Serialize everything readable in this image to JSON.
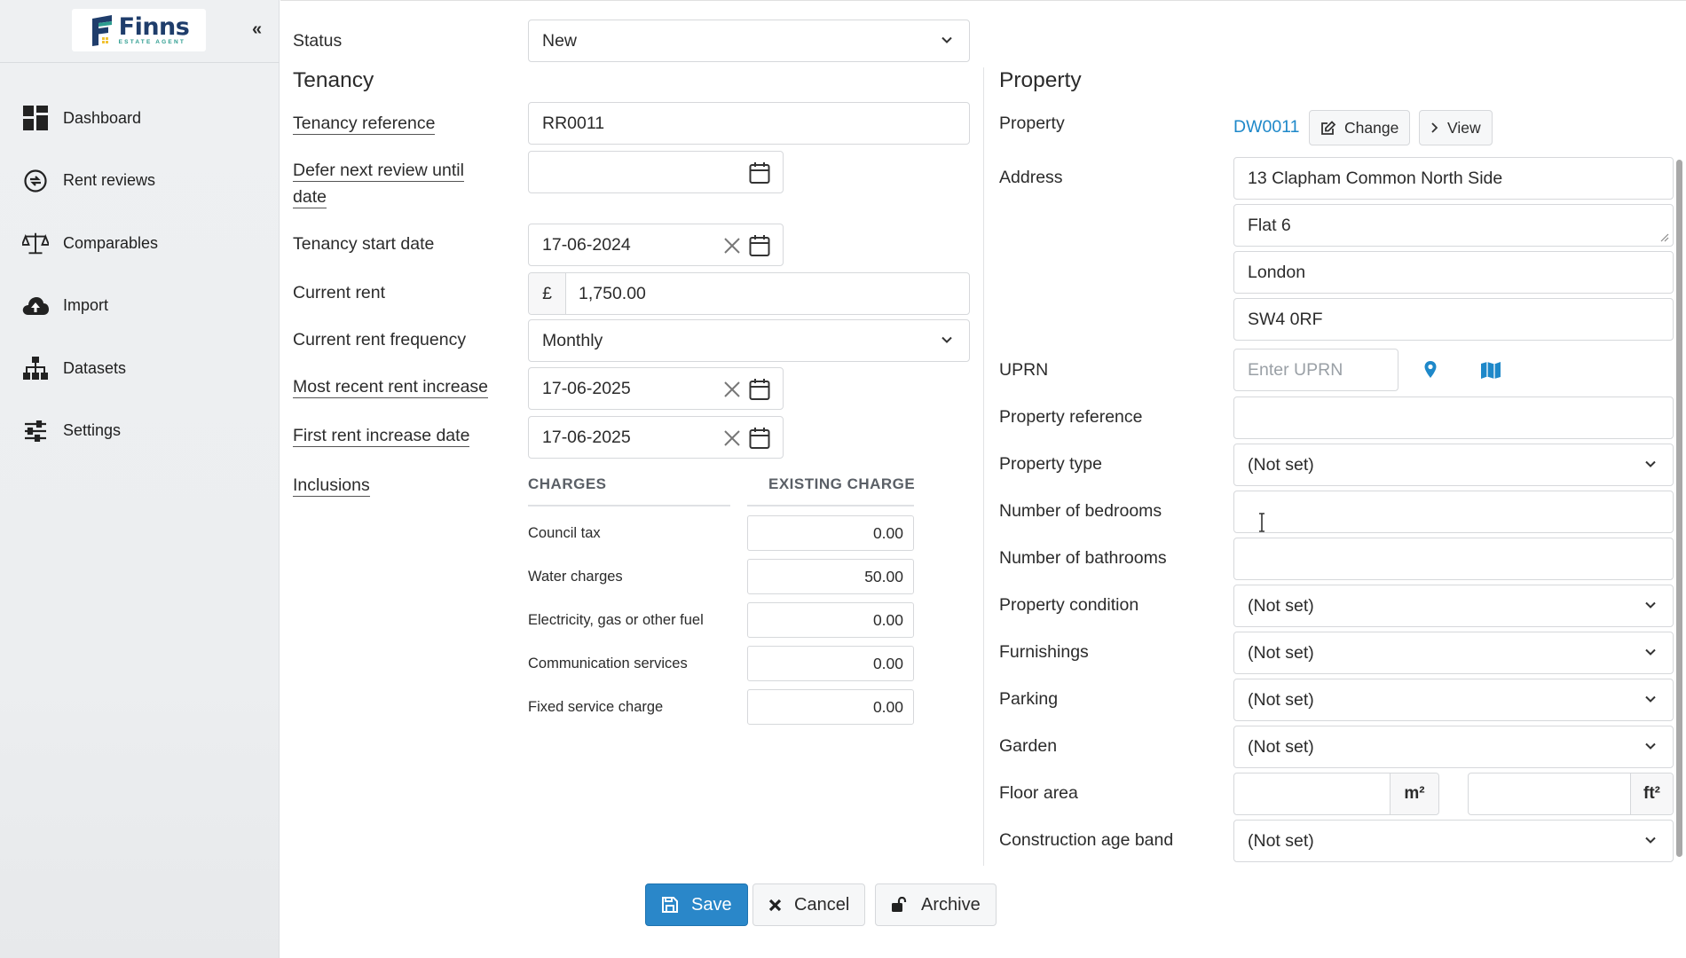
{
  "brand": {
    "name": "Finns",
    "tagline": "ESTATE AGENT"
  },
  "sidebar": {
    "collapse_icon": "«",
    "items": [
      {
        "label": "Dashboard",
        "icon": "dashboard-icon"
      },
      {
        "label": "Rent reviews",
        "icon": "rent-reviews-icon"
      },
      {
        "label": "Comparables",
        "icon": "scales-icon"
      },
      {
        "label": "Import",
        "icon": "cloud-upload-icon"
      },
      {
        "label": "Datasets",
        "icon": "sitemap-icon"
      },
      {
        "label": "Settings",
        "icon": "sliders-icon"
      }
    ]
  },
  "status": {
    "label": "Status",
    "value": "New"
  },
  "tenancy": {
    "title": "Tenancy",
    "reference": {
      "label": "Tenancy reference",
      "value": "RR0011"
    },
    "defer": {
      "label_line1": "Defer next review until",
      "label_line2": "date",
      "value": ""
    },
    "start_date": {
      "label": "Tenancy start date",
      "value": "17-06-2024"
    },
    "current_rent": {
      "label": "Current rent",
      "currency": "£",
      "value": "1,750.00"
    },
    "frequency": {
      "label": "Current rent frequency",
      "value": "Monthly"
    },
    "recent_increase": {
      "label": "Most recent rent increase",
      "value": "17-06-2025"
    },
    "first_increase": {
      "label": "First rent increase date",
      "value": "17-06-2025"
    },
    "inclusions": {
      "label": "Inclusions",
      "col_charges": "CHARGES",
      "col_existing": "EXISTING CHARGE",
      "rows": [
        {
          "name": "Council tax",
          "value": "0.00"
        },
        {
          "name": "Water charges",
          "value": "50.00"
        },
        {
          "name": "Electricity, gas or other fuel",
          "value": "0.00"
        },
        {
          "name": "Communication services",
          "value": "0.00"
        },
        {
          "name": "Fixed service charge",
          "value": "0.00"
        }
      ]
    }
  },
  "property": {
    "title": "Property",
    "property": {
      "label": "Property",
      "link": "DW0011",
      "change_label": "Change",
      "view_label": "View"
    },
    "address": {
      "label": "Address",
      "line1": "13 Clapham Common North Side",
      "line2": "Flat 6",
      "city": "London",
      "postcode": "SW4 0RF"
    },
    "uprn": {
      "label": "UPRN",
      "placeholder": "Enter UPRN"
    },
    "reference": {
      "label": "Property reference",
      "value": ""
    },
    "type": {
      "label": "Property type",
      "value": "(Not set)"
    },
    "bedrooms": {
      "label": "Number of bedrooms",
      "value": ""
    },
    "bathrooms": {
      "label": "Number of bathrooms",
      "value": ""
    },
    "condition": {
      "label": "Property condition",
      "value": "(Not set)"
    },
    "furnishings": {
      "label": "Furnishings",
      "value": "(Not set)"
    },
    "parking": {
      "label": "Parking",
      "value": "(Not set)"
    },
    "garden": {
      "label": "Garden",
      "value": "(Not set)"
    },
    "floor_area": {
      "label": "Floor area",
      "unit_m": "m²",
      "unit_ft": "ft²"
    },
    "age_band": {
      "label": "Construction age band",
      "value": "(Not set)"
    }
  },
  "actions": {
    "save": "Save",
    "cancel": "Cancel",
    "archive": "Archive"
  },
  "colors": {
    "primary": "#2a87c9",
    "link": "#1e88c9",
    "brand_navy": "#1f3d6b",
    "brand_teal": "#2c9c8f"
  }
}
